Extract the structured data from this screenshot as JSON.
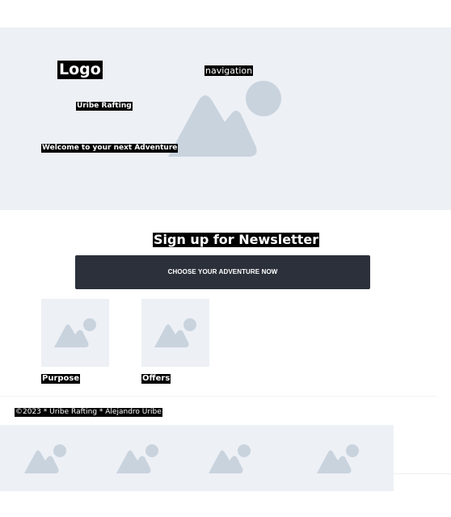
{
  "header": {
    "logo": "Logo",
    "navigation": "navigation",
    "brand": "Uribe Rafting",
    "tagline": "Welcome to your next Adventure",
    "hero_image_icon": "image-placeholder-icon"
  },
  "newsletter": {
    "title": "Sign up for Newsletter",
    "button_label": "CHOOSE YOUR ADVENTURE NOW"
  },
  "cards": [
    {
      "label": "Purpose",
      "icon": "image-placeholder-icon"
    },
    {
      "label": "Offers",
      "icon": "image-placeholder-icon"
    }
  ],
  "footer": {
    "copyright": "©2023 * Uribe Rafting * Alejandro Uribe",
    "gallery": [
      "image-placeholder-icon",
      "image-placeholder-icon",
      "image-placeholder-icon",
      "image-placeholder-icon"
    ]
  },
  "colors": {
    "placeholder_bg": "#edf0f5",
    "placeholder_icon": "#c9d3de",
    "button_bg": "#2b303a"
  }
}
